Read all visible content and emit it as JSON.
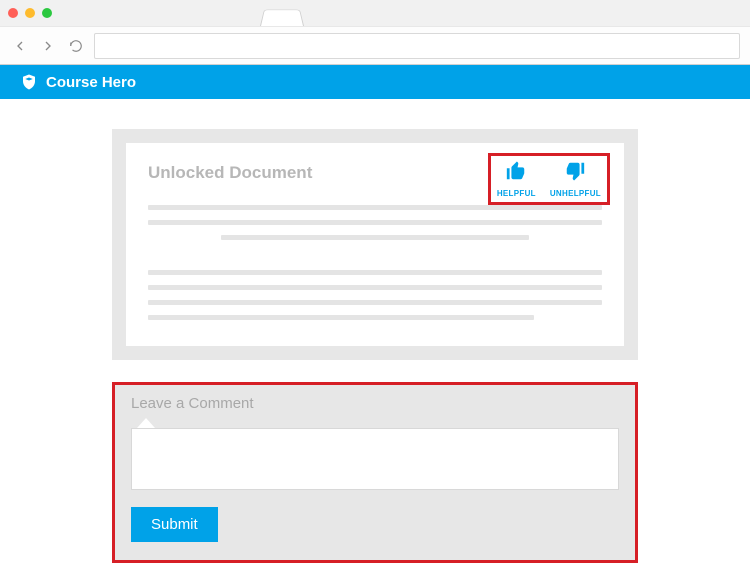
{
  "brand": {
    "name": "Course Hero"
  },
  "document": {
    "title": "Unlocked Document",
    "rating": {
      "helpful_label": "HELPFUL",
      "unhelpful_label": "UNHELPFUL"
    }
  },
  "comment": {
    "title": "Leave a Comment",
    "input_value": "",
    "submit_label": "Submit"
  },
  "colors": {
    "accent": "#00a2e8",
    "highlight": "#d61f26"
  }
}
